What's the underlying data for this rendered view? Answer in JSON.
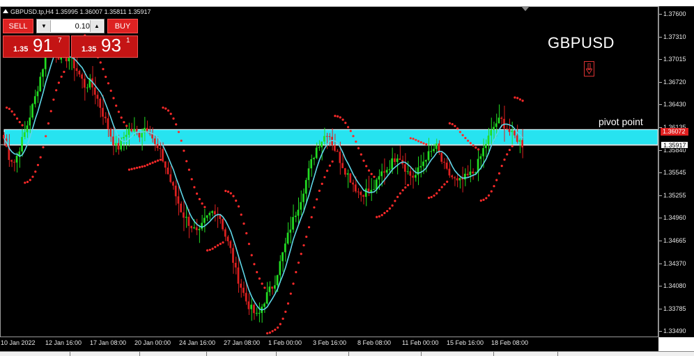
{
  "window": {
    "symbol_info": "GBPUSD.tp,H4  1.35995 1.36007 1.35811 1.35917"
  },
  "trade_panel": {
    "sell_label": "SELL",
    "buy_label": "BUY",
    "lot_value": "0.10",
    "lot_down_icon": "▼",
    "lot_up_icon": "▲",
    "sell_price_small": "1.35",
    "sell_price_big": "91",
    "sell_price_sup": "7",
    "buy_price_small": "1.35",
    "buy_price_big": "93",
    "buy_price_sup": "1"
  },
  "annotations": {
    "title": "GBPUSD",
    "arrow_icon": "down-arrow-icon",
    "pivot_label": "pivot point"
  },
  "price_axis": {
    "ticks": [
      "1.37600",
      "1.37310",
      "1.37015",
      "1.36720",
      "1.36430",
      "1.36135",
      "1.35840",
      "1.35545",
      "1.35255",
      "1.34960",
      "1.34665",
      "1.34370",
      "1.34080",
      "1.33785",
      "1.33490"
    ],
    "tag_red": "1.36072",
    "tag_white": "1.35917"
  },
  "time_axis": {
    "labels": [
      "10 Jan 2022",
      "12 Jan 16:00",
      "17 Jan 08:00",
      "20 Jan 00:00",
      "24 Jan 16:00",
      "27 Jan 08:00",
      "1 Feb 00:00",
      "3 Feb 16:00",
      "8 Feb 08:00",
      "11 Feb 00:00",
      "15 Feb 16:00",
      "18 Feb 08:00"
    ]
  },
  "colors": {
    "background": "#000000",
    "bull": "#22dd22",
    "bear": "#dd2020",
    "ma": "#5fd7e8",
    "sar": "#ff2a2a",
    "pivot_band": "#27e3f0"
  },
  "chart_data": {
    "type": "candlestick",
    "symbol": "GBPUSD",
    "timeframe": "H4",
    "ylim": [
      1.3335,
      1.3776
    ],
    "pivot_zone": [
      1.3591,
      1.3612
    ],
    "current_price": 1.35917,
    "close_series": [
      1.36,
      1.3575,
      1.3568,
      1.359,
      1.361,
      1.3635,
      1.366,
      1.369,
      1.3715,
      1.373,
      1.3712,
      1.3705,
      1.371,
      1.3698,
      1.3685,
      1.367,
      1.3675,
      1.366,
      1.364,
      1.362,
      1.36,
      1.3585,
      1.36,
      1.3612,
      1.361,
      1.3605,
      1.3615,
      1.3612,
      1.359,
      1.358,
      1.356,
      1.354,
      1.352,
      1.35,
      1.349,
      1.348,
      1.347,
      1.3488,
      1.3498,
      1.3505,
      1.3495,
      1.347,
      1.345,
      1.342,
      1.34,
      1.338,
      1.337,
      1.336,
      1.338,
      1.3395,
      1.3405,
      1.343,
      1.3455,
      1.348,
      1.35,
      1.352,
      1.3545,
      1.357,
      1.359,
      1.36,
      1.361,
      1.359,
      1.3575,
      1.356,
      1.3548,
      1.3535,
      1.3525,
      1.353,
      1.3528,
      1.354,
      1.3555,
      1.356,
      1.357,
      1.358,
      1.3565,
      1.3552,
      1.3548,
      1.356,
      1.3575,
      1.358,
      1.359,
      1.357,
      1.3555,
      1.3548,
      1.354,
      1.3545,
      1.355,
      1.3555,
      1.357,
      1.359,
      1.3605,
      1.362,
      1.3625,
      1.3615,
      1.3605,
      1.36,
      1.3592
    ]
  }
}
